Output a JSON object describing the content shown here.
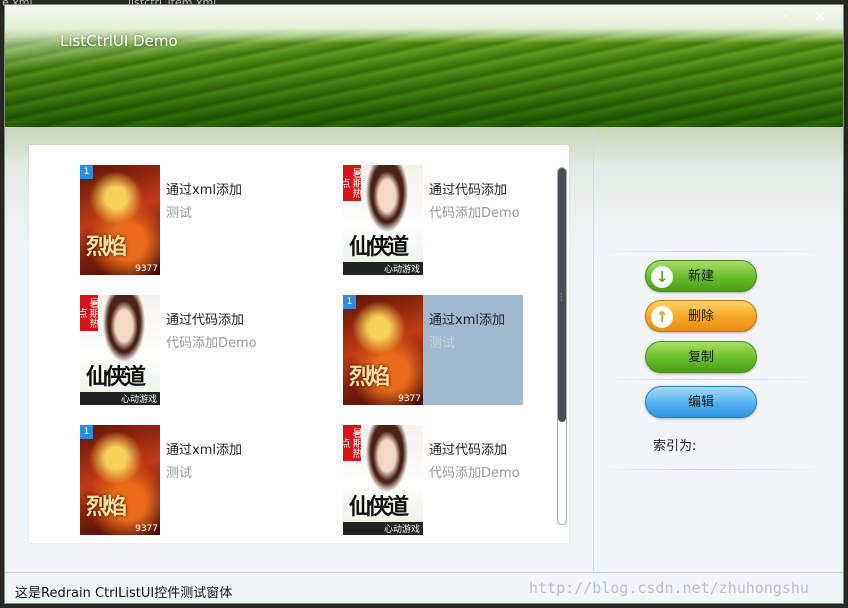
{
  "window": {
    "title": "ListCtrlUI Demo",
    "minimize_glyph": "–",
    "close_glyph": "✕"
  },
  "editor_tabs": [
    "e.xml",
    "listctrl_item.xml"
  ],
  "list": {
    "items": [
      {
        "title": "通过xml添加",
        "subtitle": "测试",
        "thumb": "fire-game-icon",
        "badge": "1",
        "caption": "9377",
        "calligraphy": "烈焰",
        "selected": false
      },
      {
        "title": "通过代码添加",
        "subtitle": "代码添加Demo",
        "thumb": "girl-game-icon",
        "badge": "暑期热点",
        "caption": "心动游戏",
        "calligraphy": "仙侠道",
        "selected": false
      },
      {
        "title": "通过代码添加",
        "subtitle": "代码添加Demo",
        "thumb": "girl-game-icon",
        "badge": "暑期热点",
        "caption": "心动游戏",
        "calligraphy": "仙侠道",
        "selected": false
      },
      {
        "title": "通过xml添加",
        "subtitle": "测试",
        "thumb": "fire-game-icon",
        "badge": "1",
        "caption": "9377",
        "calligraphy": "烈焰",
        "selected": true
      },
      {
        "title": "通过xml添加",
        "subtitle": "测试",
        "thumb": "fire-game-icon",
        "badge": "1",
        "caption": "9377",
        "calligraphy": "烈焰",
        "selected": false
      },
      {
        "title": "通过代码添加",
        "subtitle": "代码添加Demo",
        "thumb": "girl-game-icon",
        "badge": "暑期热点",
        "caption": "心动游戏",
        "calligraphy": "仙侠道",
        "selected": false
      }
    ],
    "selected_color": "#9fb8cc"
  },
  "actions": {
    "new_label": "新建",
    "delete_label": "删除",
    "copy_label": "复制",
    "edit_label": "编辑",
    "index_label": "索引为:"
  },
  "status": {
    "text": "这是Redrain CtrlListUI控件测试窗体",
    "watermark": "http://blog.csdn.net/zhuhongshu"
  },
  "colors": {
    "green_button": "#6cbf2d",
    "orange_button": "#f6a623",
    "blue_button": "#52b0f0",
    "scroll_thumb": "#4a4e52"
  }
}
